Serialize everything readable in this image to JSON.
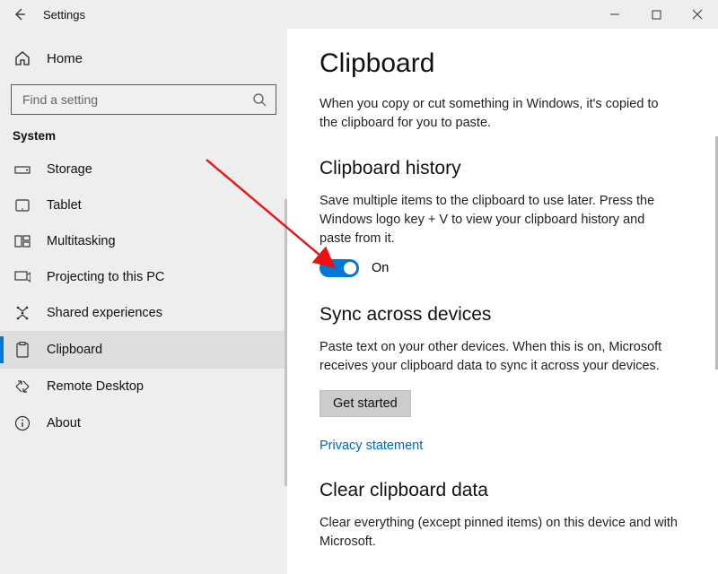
{
  "window": {
    "title": "Settings"
  },
  "sidebar": {
    "home": "Home",
    "searchPlaceholder": "Find a setting",
    "section": "System",
    "items": [
      {
        "label": "Storage"
      },
      {
        "label": "Tablet"
      },
      {
        "label": "Multitasking"
      },
      {
        "label": "Projecting to this PC"
      },
      {
        "label": "Shared experiences"
      },
      {
        "label": "Clipboard"
      },
      {
        "label": "Remote Desktop"
      },
      {
        "label": "About"
      }
    ]
  },
  "page": {
    "title": "Clipboard",
    "intro": "When you copy or cut something in Windows, it's copied to the clipboard for you to paste.",
    "history": {
      "heading": "Clipboard history",
      "desc": "Save multiple items to the clipboard to use later. Press the Windows logo key + V to view your clipboard history and paste from it.",
      "toggleState": "On"
    },
    "sync": {
      "heading": "Sync across devices",
      "desc": "Paste text on your other devices. When this is on, Microsoft receives your clipboard data to sync it across your devices.",
      "button": "Get started",
      "privacyLink": "Privacy statement"
    },
    "clear": {
      "heading": "Clear clipboard data",
      "desc": "Clear everything (except pinned items) on this device and with Microsoft."
    }
  }
}
